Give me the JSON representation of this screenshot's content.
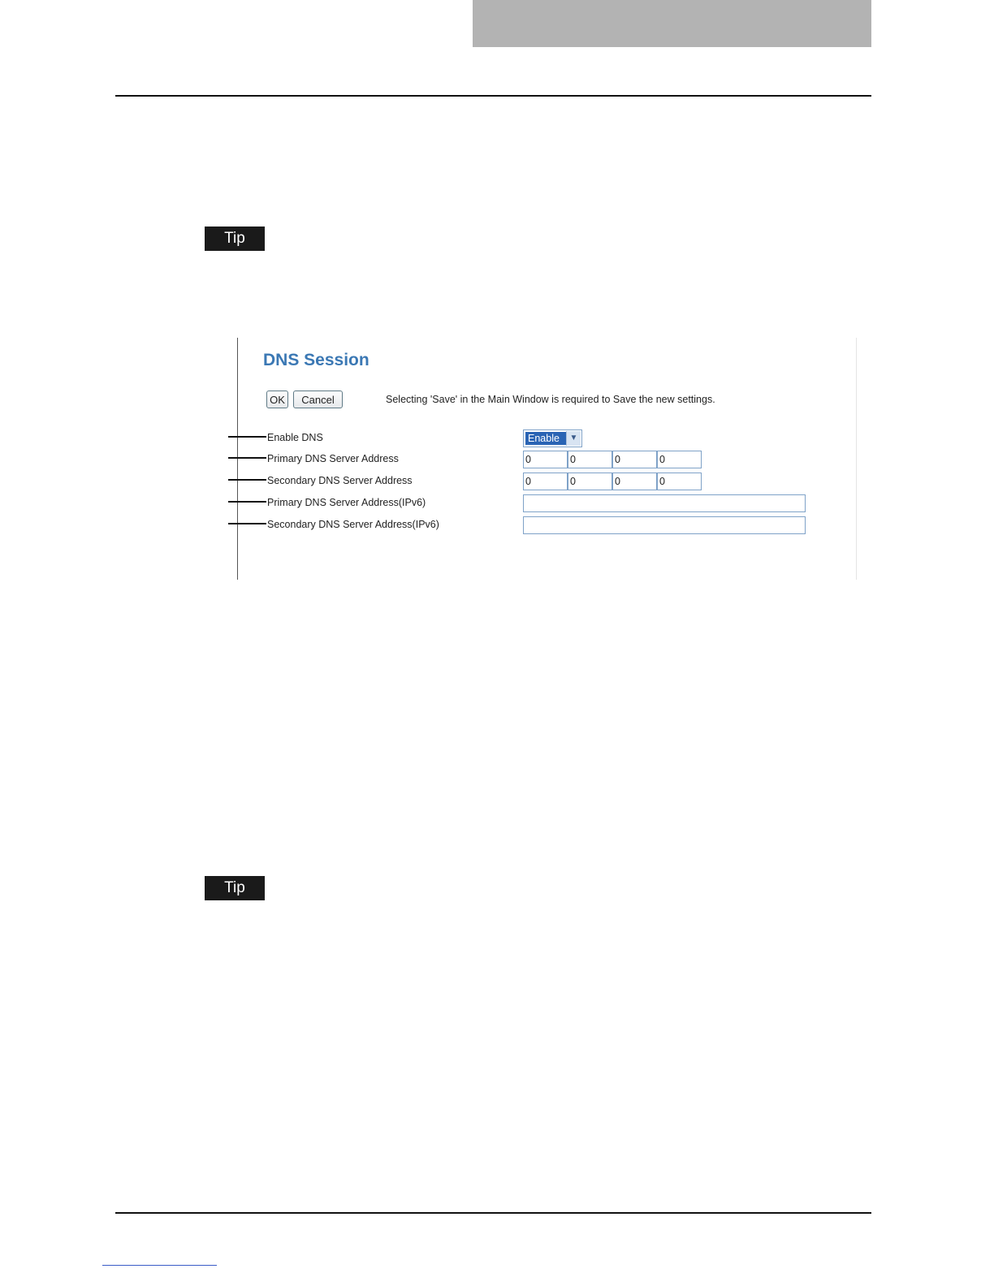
{
  "page": {
    "tip_label_1": "Tip",
    "tip_label_2": "Tip"
  },
  "dns_session": {
    "title": "DNS Session",
    "ok_label": "OK",
    "cancel_label": "Cancel",
    "notice": "Selecting 'Save' in the Main Window is required to Save the new settings.",
    "fields": [
      {
        "label": "Enable DNS",
        "type": "select",
        "value": "Enable"
      },
      {
        "label": "Primary DNS Server Address",
        "type": "ipv4",
        "octets": [
          "0",
          "0",
          "0",
          "0"
        ]
      },
      {
        "label": "Secondary DNS Server Address",
        "type": "ipv4",
        "octets": [
          "0",
          "0",
          "0",
          "0"
        ]
      },
      {
        "label": "Primary DNS Server Address(IPv6)",
        "type": "ipv6",
        "value": ""
      },
      {
        "label": "Secondary DNS Server Address(IPv6)",
        "type": "ipv6",
        "value": ""
      }
    ]
  },
  "icons": {
    "dropdown": "chevron-down-icon"
  }
}
